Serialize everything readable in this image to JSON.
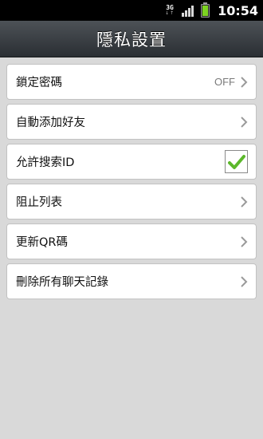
{
  "status_bar": {
    "network_type": "3G",
    "network_arrows": "↓↑",
    "signal_icon": "signal-bars-icon",
    "battery_icon": "battery-icon",
    "time": "10:54",
    "colors": {
      "background": "#000000",
      "battery_fill": "#7dd321"
    }
  },
  "title_bar": {
    "title": "隱私設置"
  },
  "settings": [
    {
      "label": "鎖定密碼",
      "value": "OFF",
      "control": "chevron"
    },
    {
      "label": "自動添加好友",
      "control": "chevron"
    },
    {
      "label": "允許搜索ID",
      "control": "checkbox",
      "checked": true
    },
    {
      "label": "阻止列表",
      "control": "chevron"
    },
    {
      "label": "更新QR碼",
      "control": "chevron"
    },
    {
      "label": "刪除所有聊天記錄",
      "control": "chevron"
    }
  ],
  "colors": {
    "page_background": "#d9d9d9",
    "row_background": "#ffffff",
    "checkmark": "#5cb82b",
    "chevron": "#9a9a9a"
  }
}
